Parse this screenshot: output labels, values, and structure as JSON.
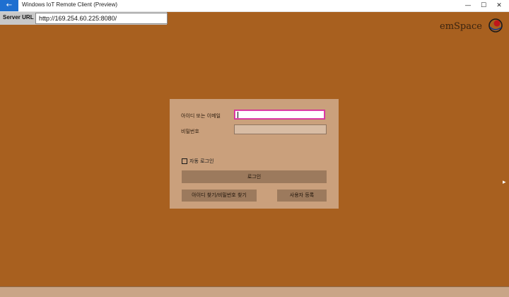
{
  "window": {
    "title": "Windows IoT Remote Client (Preview)",
    "back_icon": "←",
    "minimize_icon": "—",
    "maximize_icon": "☐",
    "close_icon": "✕"
  },
  "server": {
    "label": "Server URL :",
    "url": "http://169.254.60.225:8080/"
  },
  "logo": {
    "text": "emSpace"
  },
  "login": {
    "id_label": "아이디 또는 이메일",
    "id_value": "",
    "password_label": "비밀번호",
    "password_value": "",
    "autologin_label": "자동 로그인",
    "autologin_checked": false,
    "login_button": "로그인",
    "find_button": "아이디 찾기/비밀번호 찾기",
    "register_button": "사용자 등록"
  },
  "colors": {
    "background": "#a8601f",
    "panel": "#caa07c",
    "button": "#9c7a5d",
    "focus_border": "#d52a9a",
    "accent": "#1e6fd0"
  }
}
